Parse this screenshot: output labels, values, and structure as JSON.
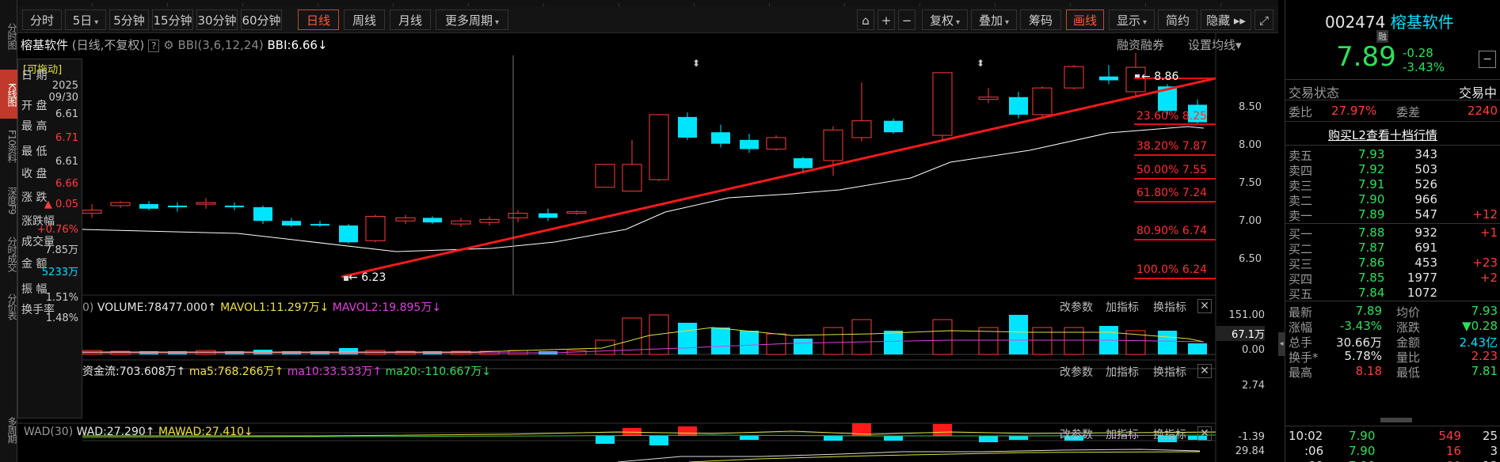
{
  "sidebar": {
    "items": [
      "分时图",
      "K线图",
      "F10资料",
      "深度F9",
      "分时成交",
      "分价表",
      "多周期"
    ],
    "active_index": 1
  },
  "toolbar": {
    "items": [
      "分时",
      "5日",
      "5分钟",
      "15分钟",
      "30分钟",
      "60分钟",
      "日线",
      "周线",
      "月线",
      "更多周期"
    ],
    "active": "日线",
    "right_items": [
      "复权",
      "叠加",
      "筹码",
      "画线",
      "显示",
      "简约",
      "隐藏"
    ],
    "active_right": "画线"
  },
  "header": {
    "stock_name": "榕基软件",
    "mode": "(日线,不复权)",
    "help": "?",
    "indicator": "BBI(3,6,12,24)",
    "bbi_value": "BBI:6.66",
    "bbi_arrow": "↓",
    "financing": "融资融券",
    "set_ma": "设置均线"
  },
  "infobox": {
    "tag": "[可拖动]",
    "rows": [
      {
        "label": "日 期",
        "value": "2025\n09/30",
        "color": "#ccc"
      },
      {
        "label": "开 盘",
        "value": "6.61",
        "color": "#ccc"
      },
      {
        "label": "最 高",
        "value": "6.71",
        "color": "#ff3d3d"
      },
      {
        "label": "最 低",
        "value": "6.61",
        "color": "#ccc"
      },
      {
        "label": "收 盘",
        "value": "6.66",
        "color": "#ff3d3d"
      },
      {
        "label": "涨 跌",
        "value": "▲ 0.05",
        "color": "#ff3d3d"
      },
      {
        "label": "涨跌幅",
        "value": "+0.76%",
        "color": "#ff3d3d"
      },
      {
        "label": "成交量",
        "value": "7.85万",
        "color": "#ccc"
      },
      {
        "label": "金 额",
        "value": "5233万",
        "color": "#00e0ff"
      },
      {
        "label": "振 幅",
        "value": "1.51%",
        "color": "#ccc"
      },
      {
        "label": "换手率",
        "value": "1.48%",
        "color": "#ccc"
      }
    ]
  },
  "price_axis": [
    "8.50",
    "8.00",
    "7.50",
    "7.00",
    "6.50"
  ],
  "fib": [
    {
      "label": "23.60% 8.25"
    },
    {
      "label": "38.20% 7.87"
    },
    {
      "label": "50.00% 7.55"
    },
    {
      "label": "61.80% 7.24"
    },
    {
      "label": "80.90% 6.74"
    },
    {
      "label": "100.0% 6.24"
    }
  ],
  "high_label": "8.86",
  "low_label": "6.23",
  "volume": {
    "title": "VOLUME:78477.000",
    "arrow": "↑",
    "mavol1": "MAVOL1:11.297万",
    "mavol1_arrow": "↓",
    "mavol2": "MAVOL2:19.895万",
    "mavol2_arrow": "↓",
    "prefix": "0)",
    "axis": [
      "151.00",
      "67.1万",
      "0.00"
    ]
  },
  "fund": {
    "title": "资金流:703.608万",
    "arrow": "↑",
    "ma5": "ma5:768.266万",
    "ma5_arrow": "↑",
    "ma10": "ma10:33.533万",
    "ma10_arrow": "↑",
    "ma20": "ma20:-110.667万",
    "ma20_arrow": "↓",
    "axis": [
      "2.74",
      "-1.39"
    ]
  },
  "wad": {
    "name": "WAD(30)",
    "title": "WAD:27.290",
    "arrow": "↑",
    "mawad": "MAWAD:27.410",
    "mawad_arrow": "↓",
    "axis": "29.84"
  },
  "panel_btns": [
    "改参数",
    "加指标",
    "换指标"
  ],
  "right": {
    "code": "002474",
    "name": "榕基软件",
    "rong": "融",
    "price": "7.89",
    "change": "-0.28",
    "pct": "-3.43%",
    "status_label": "交易状态",
    "status_value": "交易中",
    "weibi_label": "委比",
    "weibi": "27.97%",
    "weicha_label": "委差",
    "weicha": "2240",
    "l2": "购买L2查看十档行情",
    "asks": [
      {
        "label": "卖五",
        "price": "7.93",
        "vol": "343",
        "chg": ""
      },
      {
        "label": "卖四",
        "price": "7.92",
        "vol": "503",
        "chg": ""
      },
      {
        "label": "卖三",
        "price": "7.91",
        "vol": "526",
        "chg": ""
      },
      {
        "label": "卖二",
        "price": "7.90",
        "vol": "966",
        "chg": ""
      },
      {
        "label": "卖一",
        "price": "7.89",
        "vol": "547",
        "chg": "+12"
      }
    ],
    "bids": [
      {
        "label": "买一",
        "price": "7.88",
        "vol": "932",
        "chg": "+1"
      },
      {
        "label": "买二",
        "price": "7.87",
        "vol": "691",
        "chg": ""
      },
      {
        "label": "买三",
        "price": "7.86",
        "vol": "453",
        "chg": "+23"
      },
      {
        "label": "买四",
        "price": "7.85",
        "vol": "1977",
        "chg": "+2"
      },
      {
        "label": "买五",
        "price": "7.84",
        "vol": "1072",
        "chg": ""
      }
    ],
    "stats": [
      {
        "l1": "最新",
        "v1": "7.89",
        "c1": "green",
        "l2": "均价",
        "v2": "7.93",
        "c2": "green"
      },
      {
        "l1": "涨幅",
        "v1": "-3.43%",
        "c1": "green",
        "l2": "涨跌",
        "v2": "▼0.28",
        "c2": "green"
      },
      {
        "l1": "总手",
        "v1": "30.66万",
        "c1": "white",
        "l2": "金额",
        "v2": "2.43亿",
        "c2": "cyan"
      },
      {
        "l1": "换手*",
        "v1": "5.78%",
        "c1": "white",
        "l2": "量比",
        "v2": "2.23",
        "c2": "red"
      },
      {
        "l1": "最高",
        "v1": "8.18",
        "c1": "red",
        "l2": "最低",
        "v2": "7.81",
        "c2": "green"
      }
    ],
    "ticks": [
      {
        "t": "10:02",
        "p": "7.90",
        "v": "549",
        "n": "25"
      },
      {
        "t": ":06",
        "p": "7.90",
        "v": "16",
        "n": "3"
      },
      {
        "t": ":09",
        "p": "7.90",
        "v": "89",
        "n": "12"
      }
    ]
  },
  "colors": {
    "up": "#ff3d3d",
    "down": "#00e5ff",
    "trend": "#ff1a1a",
    "bbi": "#ffffff"
  }
}
